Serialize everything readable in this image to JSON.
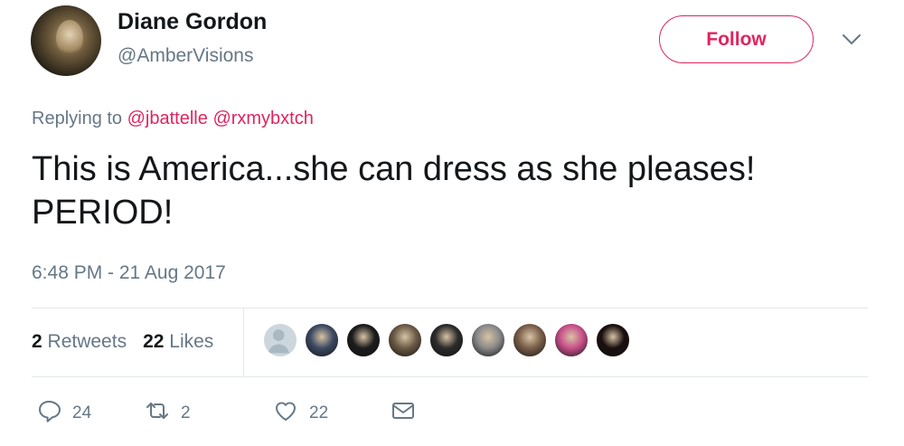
{
  "user": {
    "name": "Diane Gordon",
    "handle": "@AmberVisions"
  },
  "follow_label": "Follow",
  "reply": {
    "prefix": "Replying to",
    "mentions": [
      "@jbattelle",
      "@rxmybxtch"
    ]
  },
  "tweet_text": "This is America...she can dress as she pleases! PERIOD!",
  "timestamp": "6:48 PM - 21 Aug 2017",
  "stats": {
    "retweets_count": "2",
    "retweets_label": "Retweets",
    "likes_count": "22",
    "likes_label": "Likes"
  },
  "likers": [
    {
      "icon": "default-avatar",
      "color": "#aab8c2"
    },
    {
      "icon": "helmet-avatar",
      "color": "#3d4a63"
    },
    {
      "icon": "person-avatar",
      "color": "#1c1c1c"
    },
    {
      "icon": "person-avatar",
      "color": "#6b5a45"
    },
    {
      "icon": "person-avatar",
      "color": "#2b2b2b"
    },
    {
      "icon": "person-avatar",
      "color": "#8a8a8a"
    },
    {
      "icon": "person-avatar",
      "color": "#7a5f4a"
    },
    {
      "icon": "person-avatar",
      "color": "#c8508a"
    },
    {
      "icon": "person-avatar",
      "color": "#1a0f0f"
    }
  ],
  "actions": {
    "reply_count": "24",
    "retweet_count": "2",
    "like_count": "22"
  },
  "colors": {
    "accent": "#e0245e",
    "muted": "#657786",
    "text": "#14171a",
    "divider": "#e1e8ed"
  }
}
